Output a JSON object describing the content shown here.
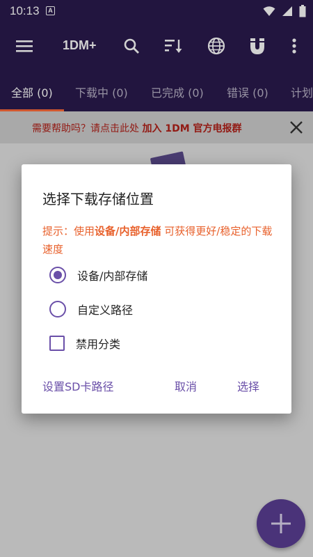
{
  "status_bar": {
    "time": "10:13",
    "notif_letter": "A"
  },
  "app_bar": {
    "title": "1DM+"
  },
  "tabs": [
    {
      "label": "全部 (0)"
    },
    {
      "label": "下载中 (0)"
    },
    {
      "label": "已完成 (0)"
    },
    {
      "label": "错误 (0)"
    },
    {
      "label": "计划"
    }
  ],
  "banner": {
    "prefix": "需要帮助吗？请点击此处 ",
    "link": "加入 1DM 官方电报群"
  },
  "dialog": {
    "title": "选择下载存储位置",
    "hint_prefix": "提示：使用",
    "hint_bold": "设备/内部存储",
    "hint_suffix": " 可获得更好/稳定的下载速度",
    "options": [
      {
        "label": "设备/内部存储",
        "selected": true
      },
      {
        "label": "自定义路径",
        "selected": false
      }
    ],
    "checkbox_label": "禁用分类",
    "buttons": {
      "sd_path": "设置SD卡路径",
      "cancel": "取消",
      "select": "选择"
    }
  },
  "colors": {
    "primary": "#2a1a4d",
    "accent": "#6a4fa8",
    "hint": "#e8612c",
    "banner_text": "#b3211a",
    "fab": "#5b3f94"
  },
  "icons": [
    "menu-icon",
    "search-icon",
    "sort-icon",
    "globe-icon",
    "magnet-icon",
    "more-vert-icon",
    "close-icon",
    "plus-icon",
    "wifi-icon",
    "signal-icon",
    "battery-icon"
  ]
}
